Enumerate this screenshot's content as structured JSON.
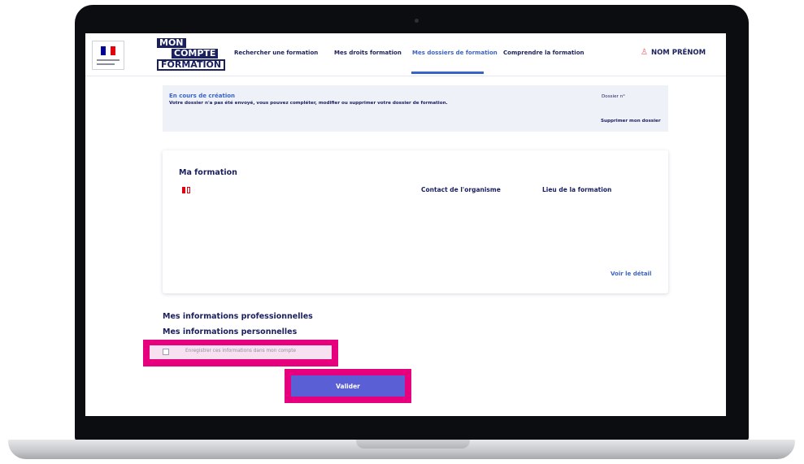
{
  "header": {
    "logo": {
      "line1": "MON",
      "line2": "COMPTE",
      "line3": "FORMATION"
    },
    "nav": [
      {
        "label": "Rechercher une formation",
        "active": false
      },
      {
        "label": "Mes droits formation",
        "active": false
      },
      {
        "label": "Mes dossiers de formation",
        "active": true
      },
      {
        "label": "Comprendre la formation",
        "active": false
      }
    ],
    "user": {
      "label": "NOM PRÉNOM",
      "icon": "user-icon"
    }
  },
  "status": {
    "title": "En cours de création",
    "text": "Votre dossier n'a pas été envoyé, vous pouvez compléter, modifier ou supprimer votre dossier de formation.",
    "dossier_label": "Dossier n°",
    "delete_label": "Supprimer mon dossier"
  },
  "formation": {
    "title": "Ma formation",
    "icon": "book-icon",
    "contact_label": "Contact de l'organisme",
    "lieu_label": "Lieu de la formation",
    "detail_link": "Voir le détail"
  },
  "sections": {
    "pro_title": "Mes informations professionnelles",
    "perso_title": "Mes informations personnelles"
  },
  "checkbox": {
    "label": "Enregistrer ces informations dans mon compte",
    "checked": false
  },
  "submit": {
    "label": "Valider"
  },
  "colors": {
    "navy": "#1a1f5e",
    "accent_blue": "#3a63c8",
    "button": "#5b5fd6",
    "highlight": "#e6007e",
    "status_bg": "#eef1f8"
  }
}
